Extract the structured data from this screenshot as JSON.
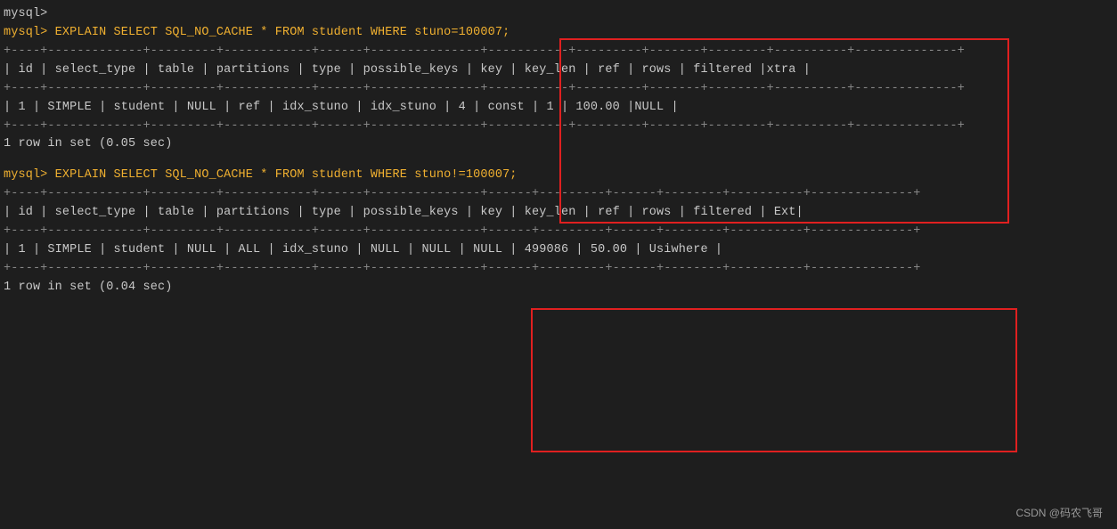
{
  "terminal": {
    "background": "#1e1e1e",
    "lines_block1": [
      {
        "type": "prompt-prev",
        "text": "mysql>"
      },
      {
        "type": "command",
        "text": "mysql> EXPLAIN SELECT SQL_NO_CACHE * FROM student WHERE stuno=100007;"
      },
      {
        "type": "dashes",
        "text": "+----+-------------+---------+------------+------+---------------+-----------+---------+-------+--------+----------+"
      },
      {
        "type": "dashes",
        "text": "----+"
      },
      {
        "type": "header",
        "text": "| id | select_type | table   | partitions | type | possible_keys | key       | key_len | ref   | rows | filtered |"
      },
      {
        "type": "header2",
        "text": "xtra |"
      },
      {
        "type": "dashes",
        "text": "+----+-------------+---------+------------+------+---------------+-----------+---------+-------+--------+----------+"
      },
      {
        "type": "dashes",
        "text": "----+"
      },
      {
        "type": "data",
        "text": "|  1 | SIMPLE      | student | NULL       | ref  | idx_stuno     | idx_stuno | 4       | const |      1 |   100.00 |"
      },
      {
        "type": "data2",
        "text": "NULL |"
      },
      {
        "type": "dashes",
        "text": "+----+-------------+---------+------------+------+---------------+-----------+---------+-------+--------+----------+"
      },
      {
        "type": "dashes",
        "text": "----+"
      },
      {
        "type": "result",
        "text": "1 row in set (0.05 sec)"
      }
    ],
    "lines_block2": [
      {
        "type": "command",
        "text": "mysql> EXPLAIN SELECT SQL_NO_CACHE * FROM student WHERE stuno!=100007;"
      },
      {
        "type": "dashes",
        "text": "+----+-------------+---------+------------+------+---------------+------+---------+------+--------+----------+----------+"
      },
      {
        "type": "dashes",
        "text": "----+"
      },
      {
        "type": "header",
        "text": "| id | select_type | table   | partitions | type | possible_keys | key  | key_len | ref  | rows   | filtered | Ext"
      },
      {
        "type": "header2",
        "text": "    |"
      },
      {
        "type": "dashes",
        "text": "+----+-------------+---------+------------+------+---------------+------+---------+------+--------+----------+----------+"
      },
      {
        "type": "dashes",
        "text": "----+"
      },
      {
        "type": "data",
        "text": "|  1 | SIMPLE      | student | NULL       | ALL  | idx_stuno     | NULL | NULL    | NULL | 499086 |    50.00 | Usi"
      },
      {
        "type": "data2",
        "text": "where |"
      },
      {
        "type": "dashes",
        "text": "+----+-------------+---------+------------+------+---------------+------+---------+------+--------+----------+----------+"
      },
      {
        "type": "dashes",
        "text": "----+"
      },
      {
        "type": "result",
        "text": "1 row in set (0.04 sec)"
      }
    ]
  },
  "watermark": {
    "text": "CSDN @码农飞哥"
  }
}
